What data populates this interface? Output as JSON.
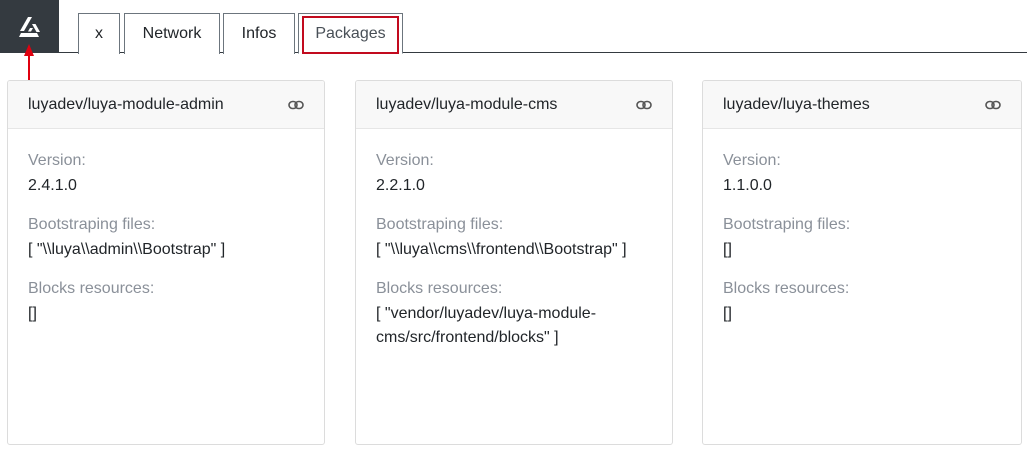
{
  "tabs": [
    {
      "label": "x"
    },
    {
      "label": "Network"
    },
    {
      "label": "Infos"
    },
    {
      "label": "Packages",
      "active": true
    }
  ],
  "colors": {
    "logo_bg": "#343a40",
    "highlight": "#c20a1e",
    "label": "#8a9099"
  },
  "icons": {
    "logo": "luya-logo-icon",
    "card_link": "link-icon",
    "annotation": "arrow-up-icon"
  },
  "packages": [
    {
      "name": "luyadev/luya-module-admin",
      "version_label": "Version:",
      "version": "2.4.1.0",
      "bootstrap_label": "Bootstraping files:",
      "bootstrap": "[ \"\\\\luya\\\\admin\\\\Bootstrap\" ]",
      "blocks_label": "Blocks resources:",
      "blocks": "[]"
    },
    {
      "name": "luyadev/luya-module-cms",
      "version_label": "Version:",
      "version": "2.2.1.0",
      "bootstrap_label": "Bootstraping files:",
      "bootstrap": "[ \"\\\\luya\\\\cms\\\\frontend\\\\Bootstrap\" ]",
      "blocks_label": "Blocks resources:",
      "blocks": "[ \"vendor/luyadev/luya-module-cms/src/frontend/blocks\" ]"
    },
    {
      "name": "luyadev/luya-themes",
      "version_label": "Version:",
      "version": "1.1.0.0",
      "bootstrap_label": "Bootstraping files:",
      "bootstrap": "[]",
      "blocks_label": "Blocks resources:",
      "blocks": "[]"
    }
  ]
}
